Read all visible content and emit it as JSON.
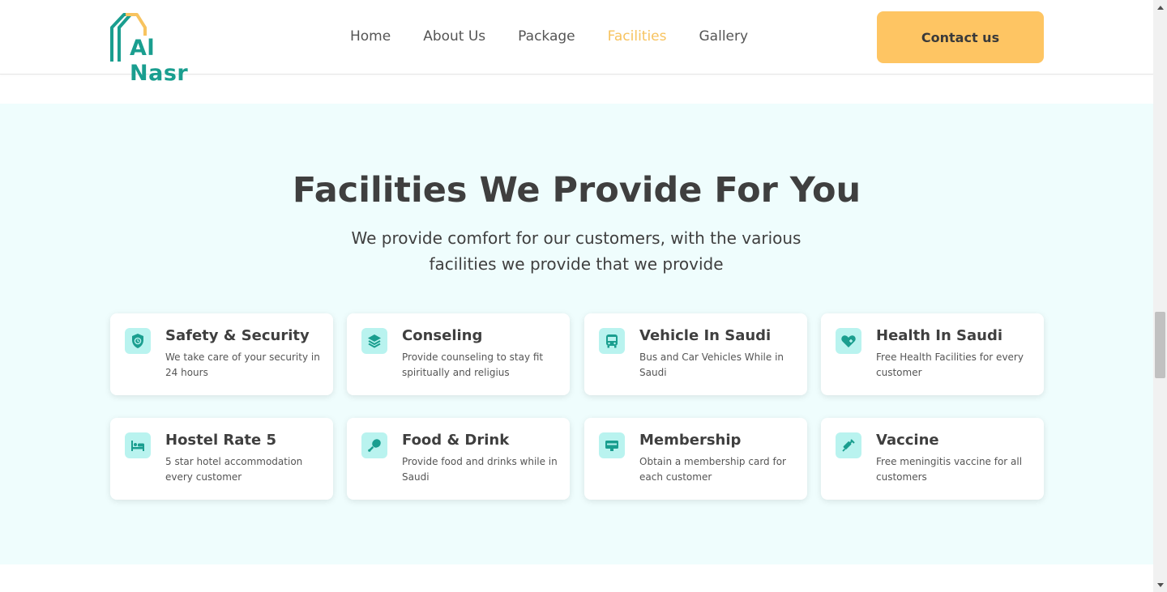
{
  "header": {
    "logo_text": "Al Nasr",
    "nav": [
      {
        "label": "Home",
        "active": false
      },
      {
        "label": "About Us",
        "active": false
      },
      {
        "label": "Package",
        "active": false
      },
      {
        "label": "Facilities",
        "active": true
      },
      {
        "label": "Gallery",
        "active": false
      }
    ],
    "contact_label": "Contact us"
  },
  "section": {
    "title": "Facilities We Provide For You",
    "subtitle": "We provide comfort for our customers, with the various facilities we provide that we provide"
  },
  "facilities": [
    {
      "title": "Safety & Security",
      "desc": "We take care of your security in 24 hours",
      "icon": "shield-clock-icon"
    },
    {
      "title": "Conseling",
      "desc": "Provide counseling to stay fit spiritually and religius",
      "icon": "layers-icon"
    },
    {
      "title": "Vehicle In Saudi",
      "desc": "Bus and Car Vehicles While in Saudi",
      "icon": "bus-icon"
    },
    {
      "title": "Health In Saudi",
      "desc": "Free Health Facilities for every customer",
      "icon": "heart-plus-icon"
    },
    {
      "title": "Hostel Rate 5",
      "desc": "5 star hotel accommodation every customer",
      "icon": "bed-icon"
    },
    {
      "title": "Food & Drink",
      "desc": "Provide food and drinks while in Saudi",
      "icon": "drumstick-icon"
    },
    {
      "title": "Membership",
      "desc": "Obtain a membership card for each customer",
      "icon": "card-icon"
    },
    {
      "title": "Vaccine",
      "desc": "Free meningitis vaccine for all customers",
      "icon": "syringe-icon"
    }
  ],
  "colors": {
    "accent": "#fec563",
    "teal": "#1a9e8f",
    "section_bg": "#effdfd",
    "icon_bg": "#b9f3ef"
  }
}
